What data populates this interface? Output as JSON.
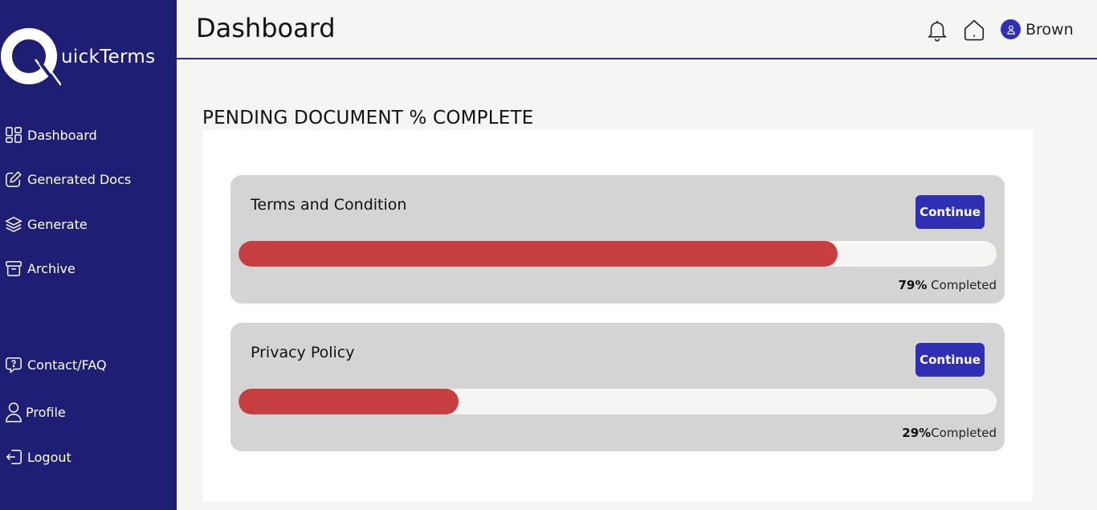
{
  "sidebar": {
    "brand": "uickTerms",
    "items": [
      {
        "label": "Dashboard",
        "icon": "dashboard-grid-icon"
      },
      {
        "label": "Generated Docs",
        "icon": "edit-icon"
      },
      {
        "label": "Generate",
        "icon": "layers-icon"
      },
      {
        "label": "Archive",
        "icon": "archive-icon"
      }
    ],
    "bottom_items": [
      {
        "label": "Contact/FAQ",
        "icon": "help-chat-icon"
      },
      {
        "label": "Profile",
        "icon": "user-icon"
      },
      {
        "label": "Logout",
        "icon": "logout-icon"
      }
    ]
  },
  "header": {
    "title": "Dashboard",
    "user_name": "Brown",
    "icons": [
      "bell-icon",
      "home-icon",
      "avatar-icon"
    ]
  },
  "main": {
    "section_title": "PENDING DOCUMENT % COMPLETE",
    "documents": [
      {
        "title": "Terms and Condition",
        "button": "Continue",
        "percent_text": "79%",
        "suffix": " Completed",
        "progress": 0.79
      },
      {
        "title": "Privacy Policy",
        "button": "Continue",
        "percent_text": "29%",
        "suffix": "Completed",
        "progress": 0.29
      }
    ]
  },
  "colors": {
    "sidebar": "#1e1f74",
    "accent": "#2e2fb3",
    "progress_fill": "#c63e40",
    "card": "#d4d4d4"
  }
}
